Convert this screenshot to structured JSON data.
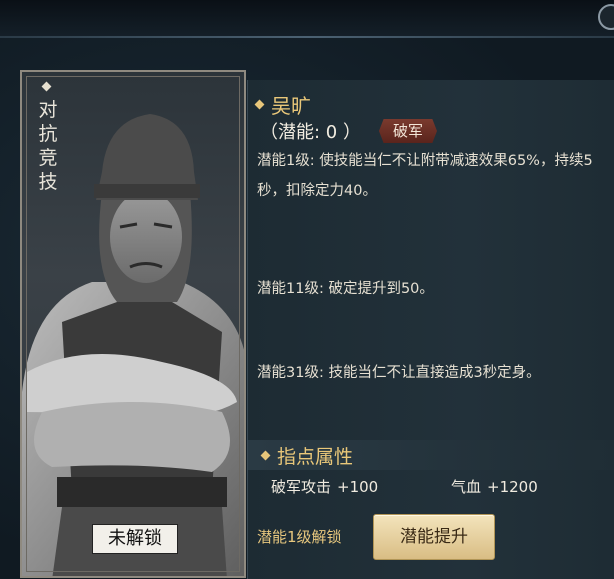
{
  "card": {
    "mode_tag": "对抗竞技",
    "lock_status": "未解锁"
  },
  "hero": {
    "name": "吴旷",
    "potential_label": "（潜能: 0 ）",
    "faction": "破军"
  },
  "potentials": [
    {
      "text": "潜能1级: 使技能当仁不让附带减速效果65%，持续5秒，扣除定力40。"
    },
    {
      "text": "潜能11级: 破定提升到50。"
    },
    {
      "text": "潜能31级: 技能当仁不让直接造成3秒定身。"
    }
  ],
  "attributes": {
    "title": "指点属性",
    "stats": [
      {
        "label": "破军攻击",
        "value": "+100"
      },
      {
        "label": "气血",
        "value": "+1200"
      }
    ]
  },
  "footer": {
    "unlock_hint": "潜能1级解锁",
    "upgrade_label": "潜能提升"
  },
  "colors": {
    "gold": "#e9c779",
    "panel": "#22313a",
    "button": "#e8d3a0",
    "faction_badge": "#6b2f25"
  }
}
